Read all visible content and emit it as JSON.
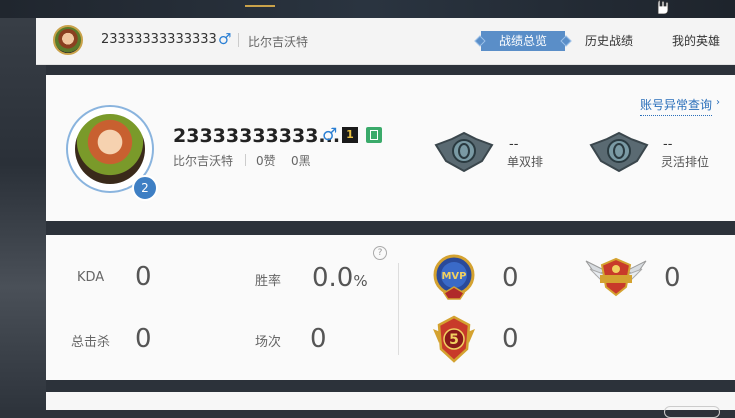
{
  "header": {
    "name": "23333333333333",
    "gender_symbol": "♂",
    "server": "比尔吉沃特",
    "tabs": [
      "战绩总览",
      "历史战绩",
      "我的英雄"
    ],
    "active_tab": "战绩总览"
  },
  "profile": {
    "abnormal_link": "账号异常查询",
    "name": "23333333333...",
    "gender_symbol": "♂",
    "vip_level": "1",
    "level": "2",
    "server": "比尔吉沃特",
    "likes": "0赞",
    "blacks": "0黑",
    "ranks": [
      {
        "label": "单双排",
        "value": "--"
      },
      {
        "label": "灵活排位",
        "value": "--"
      }
    ]
  },
  "stats": {
    "kda_label": "KDA",
    "kda_value": "0",
    "winrate_label": "胜率",
    "winrate_value": "0.0",
    "winrate_unit": "%",
    "kills_label": "总击杀",
    "kills_value": "0",
    "games_label": "场次",
    "games_value": "0",
    "help_glyph": "?",
    "badges": [
      {
        "name": "mvp-badge",
        "value": "0"
      },
      {
        "name": "legendary-badge",
        "value": "0"
      },
      {
        "name": "penta-kill-badge",
        "value": "0"
      }
    ],
    "badge_texts": {
      "mvp": "MVP",
      "penta": "5"
    }
  },
  "colors": {
    "accent": "#5a8ec8",
    "male": "#2a7fd4",
    "link": "#2a6fba"
  }
}
